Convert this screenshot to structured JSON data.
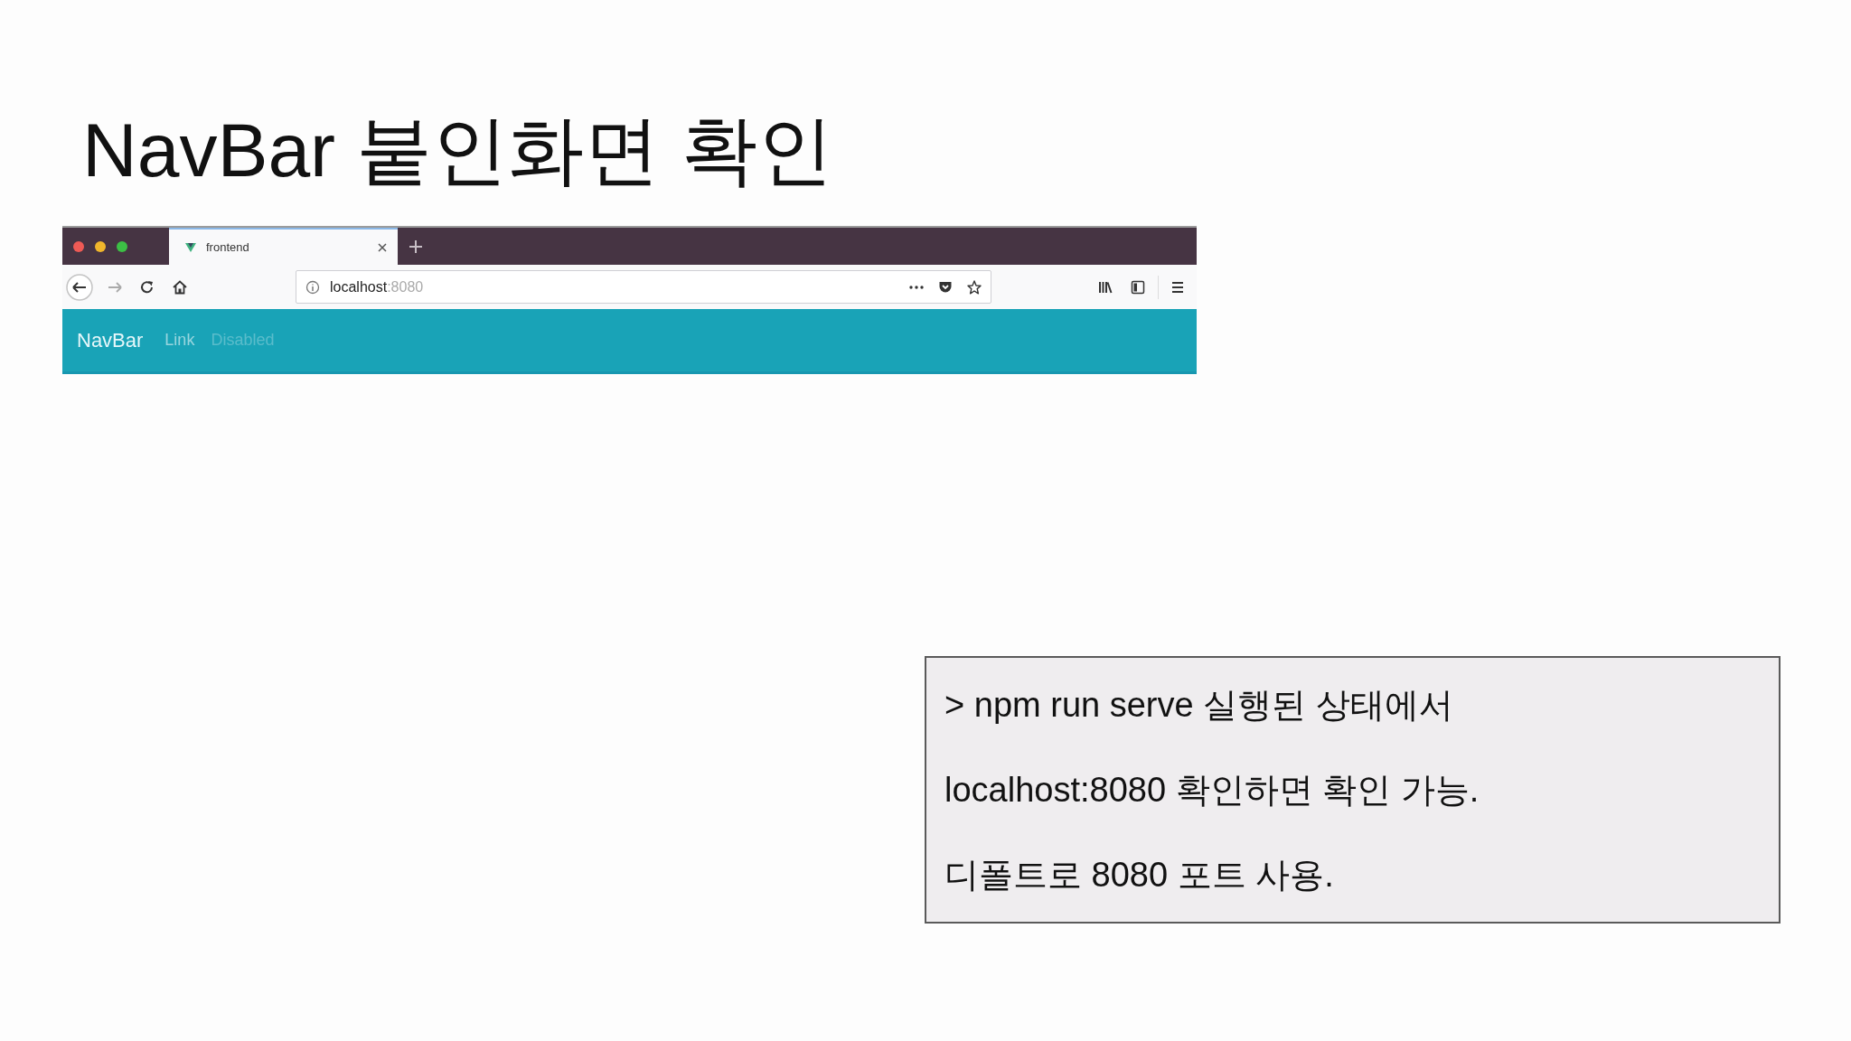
{
  "slide": {
    "title": "NavBar 붙인화면 확인"
  },
  "browser": {
    "tabs": [
      {
        "title": "frontend",
        "selected": true
      }
    ],
    "address": {
      "host": "localhost",
      "port": ":8080"
    },
    "navbar": {
      "brand": "NavBar",
      "links": [
        {
          "label": "Link",
          "disabled": false
        },
        {
          "label": "Disabled",
          "disabled": true
        }
      ]
    }
  },
  "note": {
    "lines": [
      "> npm run serve 실행된 상태에서",
      "localhost:8080 확인하면 확인 가능.",
      "디폴트로 8080 포트 사용."
    ]
  }
}
